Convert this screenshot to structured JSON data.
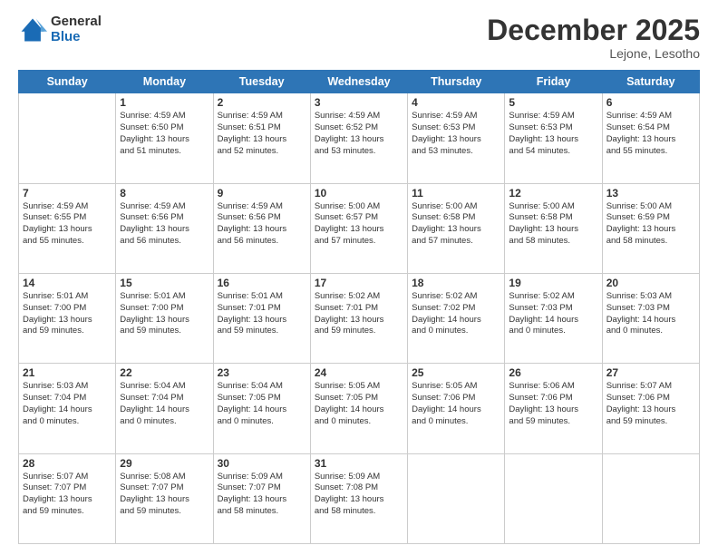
{
  "logo": {
    "general": "General",
    "blue": "Blue"
  },
  "header": {
    "month": "December 2025",
    "location": "Lejone, Lesotho"
  },
  "days": [
    "Sunday",
    "Monday",
    "Tuesday",
    "Wednesday",
    "Thursday",
    "Friday",
    "Saturday"
  ],
  "weeks": [
    [
      {
        "day": "",
        "info": ""
      },
      {
        "day": "1",
        "info": "Sunrise: 4:59 AM\nSunset: 6:50 PM\nDaylight: 13 hours\nand 51 minutes."
      },
      {
        "day": "2",
        "info": "Sunrise: 4:59 AM\nSunset: 6:51 PM\nDaylight: 13 hours\nand 52 minutes."
      },
      {
        "day": "3",
        "info": "Sunrise: 4:59 AM\nSunset: 6:52 PM\nDaylight: 13 hours\nand 53 minutes."
      },
      {
        "day": "4",
        "info": "Sunrise: 4:59 AM\nSunset: 6:53 PM\nDaylight: 13 hours\nand 53 minutes."
      },
      {
        "day": "5",
        "info": "Sunrise: 4:59 AM\nSunset: 6:53 PM\nDaylight: 13 hours\nand 54 minutes."
      },
      {
        "day": "6",
        "info": "Sunrise: 4:59 AM\nSunset: 6:54 PM\nDaylight: 13 hours\nand 55 minutes."
      }
    ],
    [
      {
        "day": "7",
        "info": "Sunrise: 4:59 AM\nSunset: 6:55 PM\nDaylight: 13 hours\nand 55 minutes."
      },
      {
        "day": "8",
        "info": "Sunrise: 4:59 AM\nSunset: 6:56 PM\nDaylight: 13 hours\nand 56 minutes."
      },
      {
        "day": "9",
        "info": "Sunrise: 4:59 AM\nSunset: 6:56 PM\nDaylight: 13 hours\nand 56 minutes."
      },
      {
        "day": "10",
        "info": "Sunrise: 5:00 AM\nSunset: 6:57 PM\nDaylight: 13 hours\nand 57 minutes."
      },
      {
        "day": "11",
        "info": "Sunrise: 5:00 AM\nSunset: 6:58 PM\nDaylight: 13 hours\nand 57 minutes."
      },
      {
        "day": "12",
        "info": "Sunrise: 5:00 AM\nSunset: 6:58 PM\nDaylight: 13 hours\nand 58 minutes."
      },
      {
        "day": "13",
        "info": "Sunrise: 5:00 AM\nSunset: 6:59 PM\nDaylight: 13 hours\nand 58 minutes."
      }
    ],
    [
      {
        "day": "14",
        "info": "Sunrise: 5:01 AM\nSunset: 7:00 PM\nDaylight: 13 hours\nand 59 minutes."
      },
      {
        "day": "15",
        "info": "Sunrise: 5:01 AM\nSunset: 7:00 PM\nDaylight: 13 hours\nand 59 minutes."
      },
      {
        "day": "16",
        "info": "Sunrise: 5:01 AM\nSunset: 7:01 PM\nDaylight: 13 hours\nand 59 minutes."
      },
      {
        "day": "17",
        "info": "Sunrise: 5:02 AM\nSunset: 7:01 PM\nDaylight: 13 hours\nand 59 minutes."
      },
      {
        "day": "18",
        "info": "Sunrise: 5:02 AM\nSunset: 7:02 PM\nDaylight: 14 hours\nand 0 minutes."
      },
      {
        "day": "19",
        "info": "Sunrise: 5:02 AM\nSunset: 7:03 PM\nDaylight: 14 hours\nand 0 minutes."
      },
      {
        "day": "20",
        "info": "Sunrise: 5:03 AM\nSunset: 7:03 PM\nDaylight: 14 hours\nand 0 minutes."
      }
    ],
    [
      {
        "day": "21",
        "info": "Sunrise: 5:03 AM\nSunset: 7:04 PM\nDaylight: 14 hours\nand 0 minutes."
      },
      {
        "day": "22",
        "info": "Sunrise: 5:04 AM\nSunset: 7:04 PM\nDaylight: 14 hours\nand 0 minutes."
      },
      {
        "day": "23",
        "info": "Sunrise: 5:04 AM\nSunset: 7:05 PM\nDaylight: 14 hours\nand 0 minutes."
      },
      {
        "day": "24",
        "info": "Sunrise: 5:05 AM\nSunset: 7:05 PM\nDaylight: 14 hours\nand 0 minutes."
      },
      {
        "day": "25",
        "info": "Sunrise: 5:05 AM\nSunset: 7:06 PM\nDaylight: 14 hours\nand 0 minutes."
      },
      {
        "day": "26",
        "info": "Sunrise: 5:06 AM\nSunset: 7:06 PM\nDaylight: 13 hours\nand 59 minutes."
      },
      {
        "day": "27",
        "info": "Sunrise: 5:07 AM\nSunset: 7:06 PM\nDaylight: 13 hours\nand 59 minutes."
      }
    ],
    [
      {
        "day": "28",
        "info": "Sunrise: 5:07 AM\nSunset: 7:07 PM\nDaylight: 13 hours\nand 59 minutes."
      },
      {
        "day": "29",
        "info": "Sunrise: 5:08 AM\nSunset: 7:07 PM\nDaylight: 13 hours\nand 59 minutes."
      },
      {
        "day": "30",
        "info": "Sunrise: 5:09 AM\nSunset: 7:07 PM\nDaylight: 13 hours\nand 58 minutes."
      },
      {
        "day": "31",
        "info": "Sunrise: 5:09 AM\nSunset: 7:08 PM\nDaylight: 13 hours\nand 58 minutes."
      },
      {
        "day": "",
        "info": ""
      },
      {
        "day": "",
        "info": ""
      },
      {
        "day": "",
        "info": ""
      }
    ]
  ]
}
